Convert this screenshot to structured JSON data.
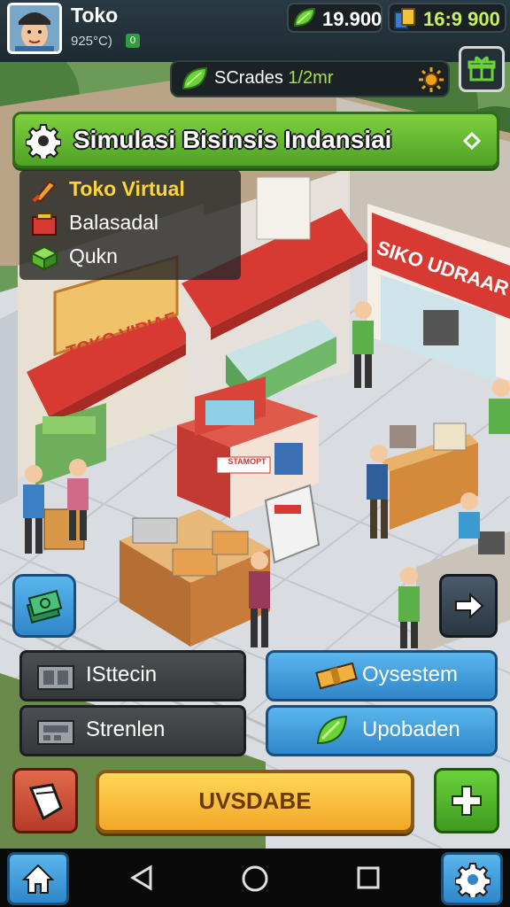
{
  "player": {
    "name": "Toko",
    "stats": "925°C)",
    "badge": "0"
  },
  "resources": {
    "gems": "19.900",
    "cash": "16:9 900"
  },
  "quest": {
    "label": "SCrades",
    "progress": "1/2mr"
  },
  "banner": {
    "title": "Simulasi Bisinsis Indansiai"
  },
  "menu": {
    "items": [
      {
        "label": "Toko Virtual",
        "color": "#ffd43a"
      },
      {
        "label": "Balasadal",
        "color": "#ffffff"
      },
      {
        "label": "Qukn",
        "color": "#ffffff"
      }
    ]
  },
  "scene": {
    "sign_left": "TOKO VIRIAE",
    "sign_right": "SIKO UDRAAR",
    "truck_text": "STAMOPT"
  },
  "actions": {
    "left": [
      {
        "label": "ISttecin"
      },
      {
        "label": "Strenlen"
      }
    ],
    "right": [
      {
        "label": "Oysestem"
      },
      {
        "label": "Upobaden"
      }
    ],
    "main_button": "UVSDABE"
  },
  "colors": {
    "accent_green": "#5cb531",
    "accent_orange": "#f3a726",
    "accent_blue": "#2f86c9",
    "awning_red": "#d63a32"
  }
}
